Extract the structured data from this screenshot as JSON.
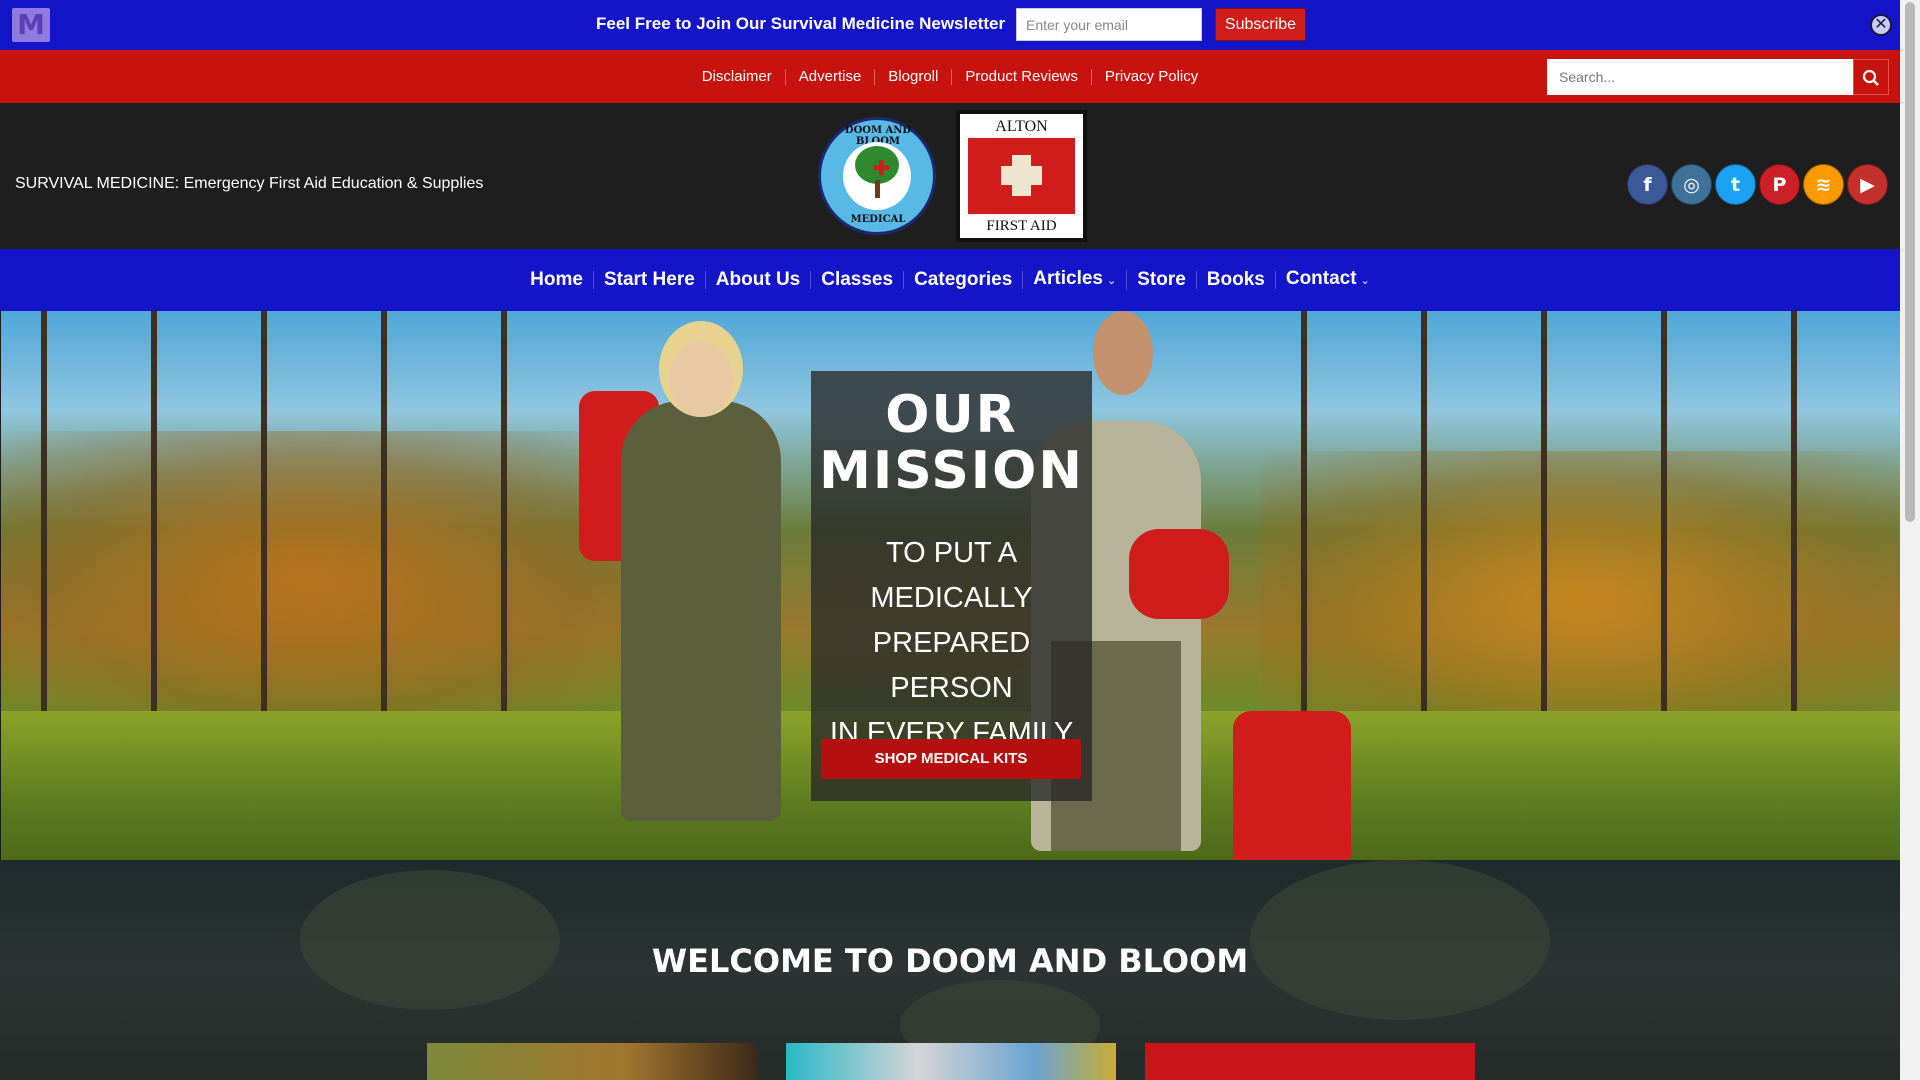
{
  "newsletter": {
    "logo_letter": "M",
    "text": "Feel Free to Join Our Survival Medicine Newsletter",
    "email_placeholder": "Enter your email",
    "subscribe_label": "Subscribe",
    "close_glyph": "✕"
  },
  "top_links": [
    "Disclaimer",
    "Advertise",
    "Blogroll",
    "Product Reviews",
    "Privacy Policy"
  ],
  "search": {
    "placeholder": "Search..."
  },
  "header": {
    "tagline": "SURVIVAL MEDICINE: Emergency First Aid Education & Supplies",
    "logo_doom_top": "DOOM AND BLOOM",
    "logo_doom_bottom": "MEDICAL",
    "logo_alton_top": "ALTON",
    "logo_alton_bottom": "FIRST AID"
  },
  "socials": [
    {
      "name": "facebook-icon",
      "glyph": "f",
      "color": "#3b5998"
    },
    {
      "name": "instagram-icon",
      "glyph": "◎",
      "color": "#3f729b"
    },
    {
      "name": "twitter-icon",
      "glyph": "t",
      "color": "#1da1f2"
    },
    {
      "name": "pinterest-icon",
      "glyph": "P",
      "color": "#cb2027"
    },
    {
      "name": "rss-icon",
      "glyph": "≋",
      "color": "#ff9900"
    },
    {
      "name": "youtube-icon",
      "glyph": "▶",
      "color": "#c4302b"
    }
  ],
  "nav": [
    {
      "label": "Home",
      "dropdown": false
    },
    {
      "label": "Start Here",
      "dropdown": false
    },
    {
      "label": "About Us",
      "dropdown": false
    },
    {
      "label": "Classes",
      "dropdown": false
    },
    {
      "label": "Categories",
      "dropdown": false
    },
    {
      "label": "Articles",
      "dropdown": true
    },
    {
      "label": "Store",
      "dropdown": false
    },
    {
      "label": "Books",
      "dropdown": false
    },
    {
      "label": "Contact",
      "dropdown": true
    }
  ],
  "hero": {
    "title_line1": "OUR",
    "title_line2": "MISSION",
    "text_lines": [
      "TO PUT A",
      "MEDICALLY",
      "PREPARED PERSON",
      "IN EVERY FAMILY"
    ],
    "button_label": "SHOP MEDICAL KITS"
  },
  "welcome": {
    "title": "WELCOME TO DOOM AND BLOOM"
  },
  "colors": {
    "newsletter_bg": "#1414c8",
    "topbar_bg": "#c8120e",
    "header_bg": "#1e1e1e",
    "nav_bg": "#1414c8",
    "button_red": "#b50f0f"
  }
}
